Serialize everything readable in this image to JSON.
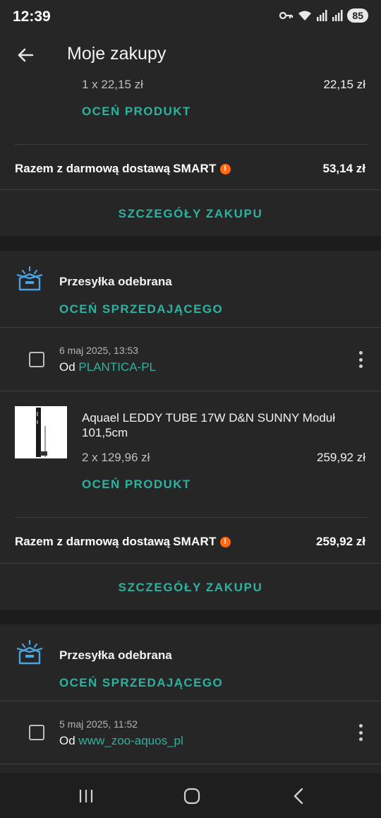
{
  "status_bar": {
    "time": "12:39",
    "battery": "85"
  },
  "app_bar": {
    "title": "Moje zakupy"
  },
  "order_prev": {
    "quantity_price": "1 x 22,15 zł",
    "line_total": "22,15 zł",
    "rate_product": "OCEŃ PRODUKT",
    "total_label": "Razem z darmową dostawą",
    "smart_label": "SMART",
    "total_value": "53,14 zł",
    "details": "SZCZEGÓŁY ZAKUPU"
  },
  "order_1": {
    "status": "Przesyłka odebrana",
    "rate_seller": "OCEŃ SPRZEDAJĄCEGO",
    "date": "6 maj 2025, 13:53",
    "from_label": "Od",
    "seller": "PLANTICA-PL",
    "product_name": "Aquael LEDDY TUBE 17W D&N SUNNY Moduł 101,5cm",
    "quantity_price": "2 x 129,96 zł",
    "line_total": "259,92 zł",
    "rate_product": "OCEŃ PRODUKT",
    "total_label": "Razem z darmową dostawą",
    "smart_label": "SMART",
    "total_value": "259,92 zł",
    "details": "SZCZEGÓŁY ZAKUPU"
  },
  "order_2": {
    "status": "Przesyłka odebrana",
    "rate_seller": "OCEŃ SPRZEDAJĄCEGO",
    "date": "5 maj 2025, 11:52",
    "from_label": "Od",
    "seller": "www_zoo-aquos_pl"
  },
  "colors": {
    "accent": "#2bb3a0",
    "smart_badge": "#ff6a13",
    "card_bg": "#262626",
    "page_bg": "#1c1c1c"
  },
  "icons": [
    "key-icon",
    "wifi-icon",
    "signal-icon",
    "back-arrow-icon",
    "box-icon",
    "more-vert-icon",
    "recent-apps-icon",
    "home-icon",
    "nav-back-icon"
  ]
}
